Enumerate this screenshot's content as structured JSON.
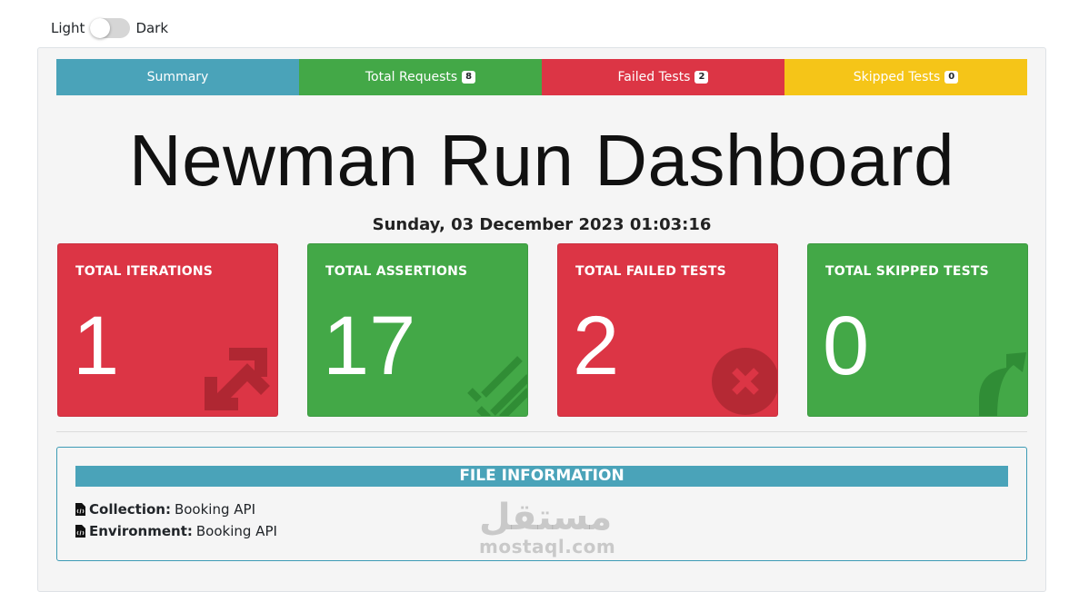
{
  "theme_toggle": {
    "light_label": "Light",
    "dark_label": "Dark"
  },
  "tabs": [
    {
      "label": "Summary",
      "badge": null,
      "color": "#4aa3b9"
    },
    {
      "label": "Total Requests",
      "badge": "8",
      "color": "#43a847"
    },
    {
      "label": "Failed Tests",
      "badge": "2",
      "color": "#dc3545"
    },
    {
      "label": "Skipped Tests",
      "badge": "0",
      "color": "#f5c518"
    }
  ],
  "page_title": "Newman Run Dashboard",
  "run_datetime": "Sunday, 03 December 2023 01:03:16",
  "cards": [
    {
      "title": "TOTAL ITERATIONS",
      "value": "1",
      "color": "#dc3545",
      "icon": "sync-icon"
    },
    {
      "title": "TOTAL ASSERTIONS",
      "value": "17",
      "color": "#43a847",
      "icon": "list-check-icon"
    },
    {
      "title": "TOTAL FAILED TESTS",
      "value": "2",
      "color": "#dc3545",
      "icon": "times-circle-icon"
    },
    {
      "title": "TOTAL SKIPPED TESTS",
      "value": "0",
      "color": "#43a847",
      "icon": "share-arrow-icon"
    }
  ],
  "file_information": {
    "header": "FILE INFORMATION",
    "collection_label": "Collection:",
    "collection_value": "Booking API",
    "environment_label": "Environment:",
    "environment_value": "Booking API"
  },
  "watermark": {
    "arabic": "مستقل",
    "latin": "mostaql.com"
  }
}
